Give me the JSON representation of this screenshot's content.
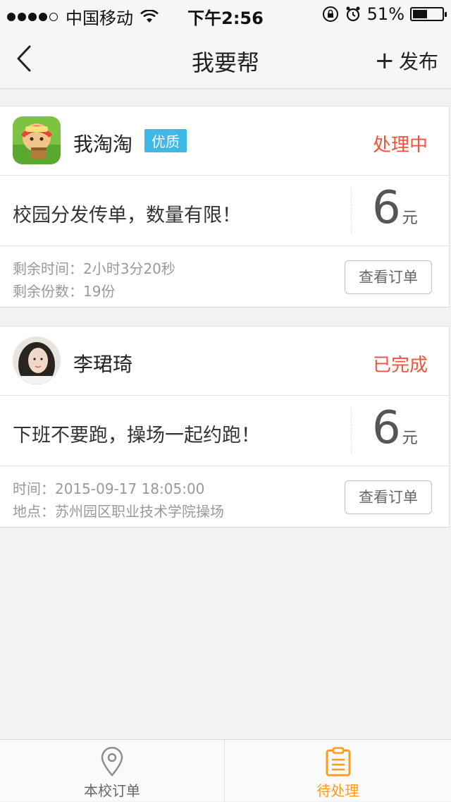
{
  "status_bar": {
    "carrier": "中国移动",
    "time": "下午2:56",
    "battery": "51%",
    "battery_level": 0.51
  },
  "nav": {
    "title": "我要帮",
    "publish_label": "发布",
    "back_icon": "chevron-left-icon",
    "publish_icon": "plus-icon"
  },
  "orders": [
    {
      "user": "我淘淘",
      "badge": "优质",
      "status": "处理中",
      "title": "校园分发传单，数量有限！",
      "price": "6",
      "unit": "元",
      "line1": "剩余时间：2小时3分20秒",
      "line2": "剩余份数：19份",
      "button": "查看订单"
    },
    {
      "user": "李珺琦",
      "status": "已完成",
      "title": "下班不要跑，操场一起约跑！",
      "price": "6",
      "unit": "元",
      "line1": "时间：2015-09-17 18:05:00",
      "line2": "地点：苏州园区职业技术学院操场",
      "button": "查看订单"
    }
  ],
  "tabs": [
    {
      "label": "本校订单",
      "icon": "location-pin-icon",
      "active": false
    },
    {
      "label": "待处理",
      "icon": "clipboard-icon",
      "active": true
    }
  ],
  "colors": {
    "accent_orange": "#ff9a1a",
    "status_red": "#f0543c",
    "badge_blue": "#3fb8e8"
  }
}
